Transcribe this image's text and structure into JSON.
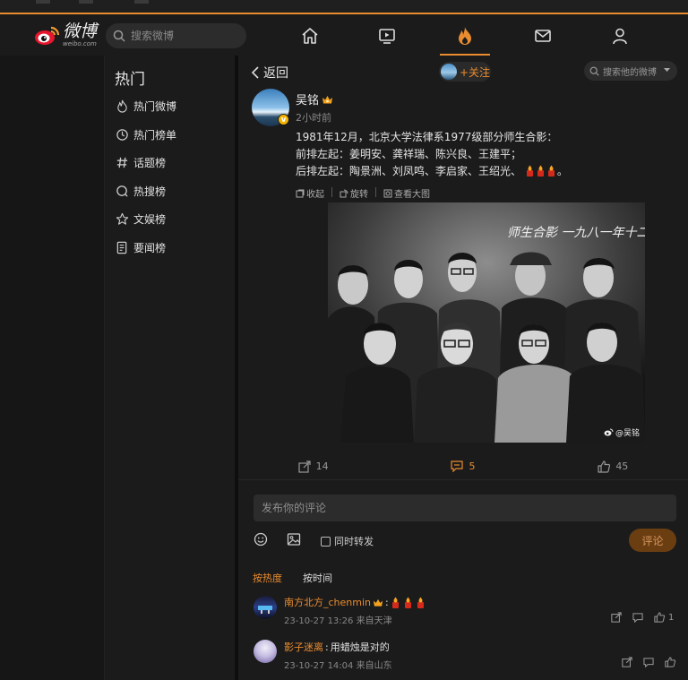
{
  "topbar": {
    "logo_cn": "微博",
    "logo_en": "weibo.com",
    "search_placeholder": "搜索微博",
    "nav": [
      "home-icon",
      "video-icon",
      "hot-flame-icon",
      "message-icon",
      "profile-icon"
    ],
    "active_nav": "hot-flame-icon",
    "accent": "#e98c2f"
  },
  "sidebar": {
    "title": "热门",
    "items": [
      {
        "label": "热门微博",
        "icon": "flame-icon"
      },
      {
        "label": "热门榜单",
        "icon": "clock-icon"
      },
      {
        "label": "话题榜",
        "icon": "hash-icon"
      },
      {
        "label": "热搜榜",
        "icon": "search-ring-icon"
      },
      {
        "label": "文娱榜",
        "icon": "star-icon"
      },
      {
        "label": "要闻榜",
        "icon": "news-icon"
      }
    ]
  },
  "header": {
    "back_label": "返回",
    "follow_label": "+关注",
    "search_placeholder": "搜索他的微博"
  },
  "post": {
    "author": "吴铭",
    "time": "2小时前",
    "lines": [
      "1981年12月，北京大学法律系1977级部分师生合影：",
      "前排左起：姜明安、龚祥瑞、陈兴良、王建平；",
      "后排左起：陶景洲、刘凤鸣、李启家、王绍光、"
    ],
    "line_end": "。",
    "tools": [
      "收起",
      "旋转",
      "查看大图"
    ],
    "photo_caption": "师生合影 一九八一年十二月",
    "watermark": "@吴铭",
    "actions": {
      "repost": "14",
      "comment": "5",
      "like": "45"
    }
  },
  "composer": {
    "placeholder": "发布你的评论",
    "repost_label": "同时转发",
    "submit_label": "评论"
  },
  "sort": {
    "hot": "按热度",
    "time": "按时间"
  },
  "comments": [
    {
      "name": "南方北方_chenmin",
      "sep": ":",
      "text": "",
      "meta": "23-10-27 13:26 来自天津",
      "likes": "1"
    },
    {
      "name": "影子迷离",
      "sep": ":",
      "text": "用蜡烛是对的",
      "meta": "23-10-27 14:04 来自山东",
      "likes": ""
    }
  ]
}
